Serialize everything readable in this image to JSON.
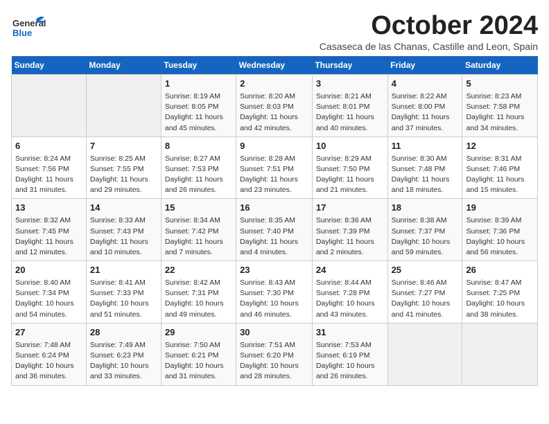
{
  "logo": {
    "line1": "General",
    "line2": "Blue"
  },
  "title": "October 2024",
  "location": "Casaseca de las Chanas, Castille and Leon, Spain",
  "days_of_week": [
    "Sunday",
    "Monday",
    "Tuesday",
    "Wednesday",
    "Thursday",
    "Friday",
    "Saturday"
  ],
  "rows": [
    [
      {
        "day": "",
        "empty": true
      },
      {
        "day": "",
        "empty": true
      },
      {
        "day": "1",
        "sunrise": "8:19 AM",
        "sunset": "8:05 PM",
        "daylight": "11 hours and 45 minutes."
      },
      {
        "day": "2",
        "sunrise": "8:20 AM",
        "sunset": "8:03 PM",
        "daylight": "11 hours and 42 minutes."
      },
      {
        "day": "3",
        "sunrise": "8:21 AM",
        "sunset": "8:01 PM",
        "daylight": "11 hours and 40 minutes."
      },
      {
        "day": "4",
        "sunrise": "8:22 AM",
        "sunset": "8:00 PM",
        "daylight": "11 hours and 37 minutes."
      },
      {
        "day": "5",
        "sunrise": "8:23 AM",
        "sunset": "7:58 PM",
        "daylight": "11 hours and 34 minutes."
      }
    ],
    [
      {
        "day": "6",
        "sunrise": "8:24 AM",
        "sunset": "7:56 PM",
        "daylight": "11 hours and 31 minutes."
      },
      {
        "day": "7",
        "sunrise": "8:25 AM",
        "sunset": "7:55 PM",
        "daylight": "11 hours and 29 minutes."
      },
      {
        "day": "8",
        "sunrise": "8:27 AM",
        "sunset": "7:53 PM",
        "daylight": "11 hours and 26 minutes."
      },
      {
        "day": "9",
        "sunrise": "8:28 AM",
        "sunset": "7:51 PM",
        "daylight": "11 hours and 23 minutes."
      },
      {
        "day": "10",
        "sunrise": "8:29 AM",
        "sunset": "7:50 PM",
        "daylight": "11 hours and 21 minutes."
      },
      {
        "day": "11",
        "sunrise": "8:30 AM",
        "sunset": "7:48 PM",
        "daylight": "11 hours and 18 minutes."
      },
      {
        "day": "12",
        "sunrise": "8:31 AM",
        "sunset": "7:46 PM",
        "daylight": "11 hours and 15 minutes."
      }
    ],
    [
      {
        "day": "13",
        "sunrise": "8:32 AM",
        "sunset": "7:45 PM",
        "daylight": "11 hours and 12 minutes."
      },
      {
        "day": "14",
        "sunrise": "8:33 AM",
        "sunset": "7:43 PM",
        "daylight": "11 hours and 10 minutes."
      },
      {
        "day": "15",
        "sunrise": "8:34 AM",
        "sunset": "7:42 PM",
        "daylight": "11 hours and 7 minutes."
      },
      {
        "day": "16",
        "sunrise": "8:35 AM",
        "sunset": "7:40 PM",
        "daylight": "11 hours and 4 minutes."
      },
      {
        "day": "17",
        "sunrise": "8:36 AM",
        "sunset": "7:39 PM",
        "daylight": "11 hours and 2 minutes."
      },
      {
        "day": "18",
        "sunrise": "8:38 AM",
        "sunset": "7:37 PM",
        "daylight": "10 hours and 59 minutes."
      },
      {
        "day": "19",
        "sunrise": "8:39 AM",
        "sunset": "7:36 PM",
        "daylight": "10 hours and 56 minutes."
      }
    ],
    [
      {
        "day": "20",
        "sunrise": "8:40 AM",
        "sunset": "7:34 PM",
        "daylight": "10 hours and 54 minutes."
      },
      {
        "day": "21",
        "sunrise": "8:41 AM",
        "sunset": "7:33 PM",
        "daylight": "10 hours and 51 minutes."
      },
      {
        "day": "22",
        "sunrise": "8:42 AM",
        "sunset": "7:31 PM",
        "daylight": "10 hours and 49 minutes."
      },
      {
        "day": "23",
        "sunrise": "8:43 AM",
        "sunset": "7:30 PM",
        "daylight": "10 hours and 46 minutes."
      },
      {
        "day": "24",
        "sunrise": "8:44 AM",
        "sunset": "7:28 PM",
        "daylight": "10 hours and 43 minutes."
      },
      {
        "day": "25",
        "sunrise": "8:46 AM",
        "sunset": "7:27 PM",
        "daylight": "10 hours and 41 minutes."
      },
      {
        "day": "26",
        "sunrise": "8:47 AM",
        "sunset": "7:25 PM",
        "daylight": "10 hours and 38 minutes."
      }
    ],
    [
      {
        "day": "27",
        "sunrise": "7:48 AM",
        "sunset": "6:24 PM",
        "daylight": "10 hours and 36 minutes."
      },
      {
        "day": "28",
        "sunrise": "7:49 AM",
        "sunset": "6:23 PM",
        "daylight": "10 hours and 33 minutes."
      },
      {
        "day": "29",
        "sunrise": "7:50 AM",
        "sunset": "6:21 PM",
        "daylight": "10 hours and 31 minutes."
      },
      {
        "day": "30",
        "sunrise": "7:51 AM",
        "sunset": "6:20 PM",
        "daylight": "10 hours and 28 minutes."
      },
      {
        "day": "31",
        "sunrise": "7:53 AM",
        "sunset": "6:19 PM",
        "daylight": "10 hours and 26 minutes."
      },
      {
        "day": "",
        "empty": true
      },
      {
        "day": "",
        "empty": true
      }
    ]
  ],
  "labels": {
    "sunrise": "Sunrise:",
    "sunset": "Sunset:",
    "daylight": "Daylight:"
  }
}
